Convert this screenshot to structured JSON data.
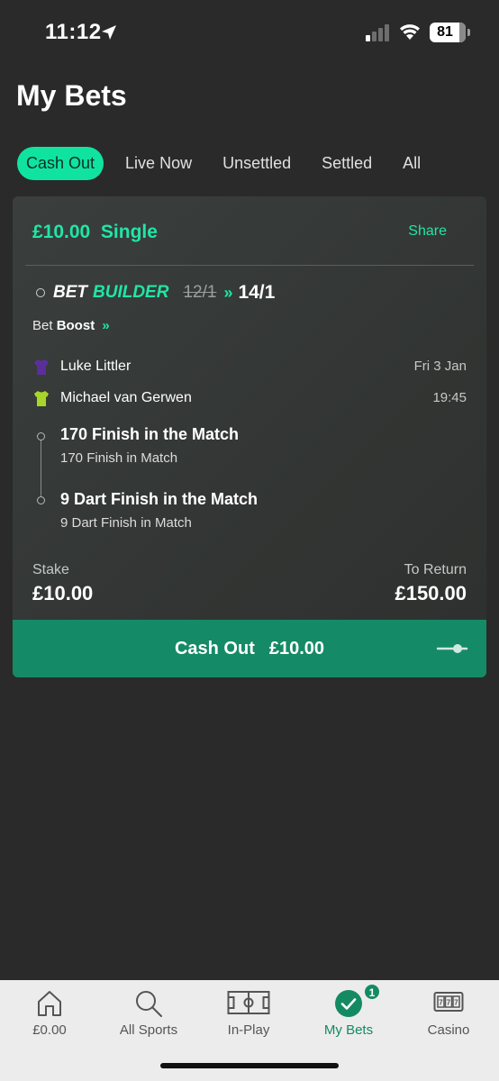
{
  "status_bar": {
    "time": "11:12",
    "battery": "81"
  },
  "header": {
    "title": "My Bets"
  },
  "tabs": [
    {
      "label": "Cash Out",
      "active": true
    },
    {
      "label": "Live Now"
    },
    {
      "label": "Unsettled"
    },
    {
      "label": "Settled"
    },
    {
      "label": "All"
    }
  ],
  "bet": {
    "stake_type": "£10.00  Single",
    "share": "Share",
    "builder_word1": "BET",
    "builder_word2": "BUILDER",
    "old_odds": "12/1",
    "arrows": "»",
    "new_odds": "14/1",
    "boost_prefix": "Bet",
    "boost_word": "Boost",
    "boost_arrows": "»",
    "players": [
      {
        "name": "Luke Littler",
        "shirt_color": "#5b2f9a"
      },
      {
        "name": "Michael van Gerwen",
        "shirt_color": "#a6d62a"
      }
    ],
    "date": "Fri 3 Jan",
    "time": "19:45",
    "selections": [
      {
        "title": "170 Finish in the Match",
        "subtitle": "170 Finish in Match"
      },
      {
        "title": "9 Dart Finish in the Match",
        "subtitle": "9 Dart Finish in Match"
      }
    ],
    "stake_label": "Stake",
    "stake_value": "£10.00",
    "return_label": "To Return",
    "return_value": "£150.00",
    "cashout_label": "Cash Out",
    "cashout_value": "£10.00"
  },
  "bottom_nav": [
    {
      "label": "£0.00",
      "icon": "home-icon"
    },
    {
      "label": "All Sports",
      "icon": "search-icon"
    },
    {
      "label": "In-Play",
      "icon": "pitch-icon"
    },
    {
      "label": "My Bets",
      "icon": "check-circle-icon",
      "active": true,
      "badge": "1"
    },
    {
      "label": "Casino",
      "icon": "slot-machine-icon"
    }
  ],
  "colors": {
    "accent": "#20e6a6",
    "cashout_bg": "#158a66",
    "bg": "#2a2a2a"
  }
}
